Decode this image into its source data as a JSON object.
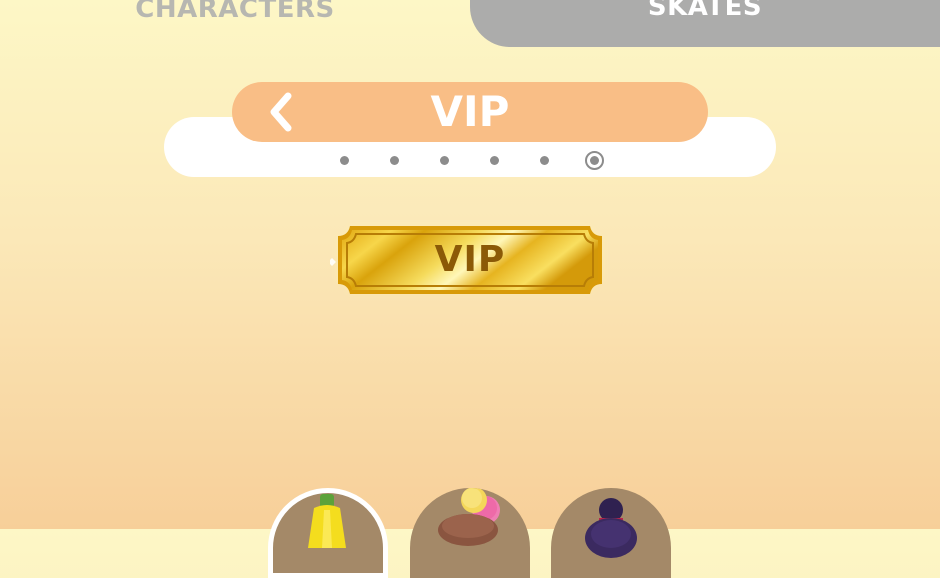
{
  "tabs": {
    "characters_label": "CHARACTERS",
    "skates_label": "SKATES",
    "active": "skates"
  },
  "category": {
    "title": "VIP",
    "page_count": 6,
    "current_page": 6
  },
  "badge": {
    "label": "VIP"
  },
  "slots": [
    {
      "name": "banana-character",
      "selected": true
    },
    {
      "name": "ice-cream-character",
      "selected": false
    },
    {
      "name": "dark-hair-character",
      "selected": false
    }
  ],
  "colors": {
    "header": "#f9be86",
    "tab_inactive": "#acacab",
    "gold": "#e8b820",
    "badge_text": "#8b5a07"
  }
}
